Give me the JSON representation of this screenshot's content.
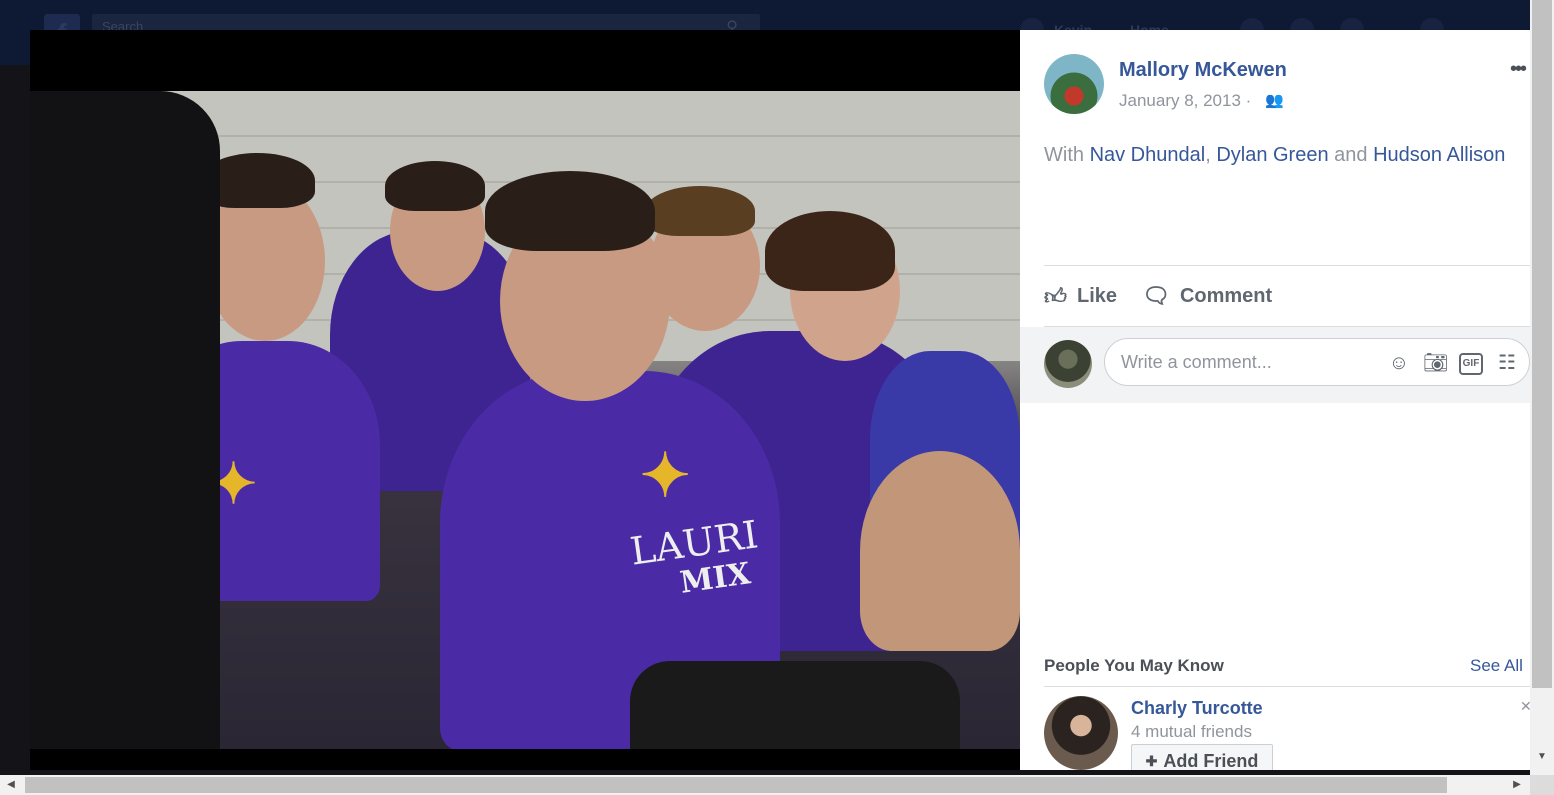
{
  "background_header": {
    "search_placeholder": "Search",
    "user_name": "Kevin",
    "home_label": "Home"
  },
  "post": {
    "author": "Mallory McKewen",
    "date": "January 8, 2013",
    "date_separator": "·",
    "audience_icon": "friends-icon",
    "tagline_prefix": "With",
    "tagged": [
      "Nav Dhundal",
      "Dylan Green",
      "Hudson Allison"
    ],
    "tag_separator": ",",
    "tag_conjunction": "and",
    "more_icon": "ellipsis-icon"
  },
  "actions": {
    "like_label": "Like",
    "comment_label": "Comment"
  },
  "comment": {
    "placeholder": "Write a comment...",
    "icons": [
      "emoji-icon",
      "camera-icon",
      "gif-icon",
      "sticker-icon"
    ],
    "gif_text": "GIF"
  },
  "pymk": {
    "title": "People You May Know",
    "see_all": "See All",
    "person": {
      "name": "Charly Turcotte",
      "mutual": "4 mutual friends",
      "add_label": "Add Friend"
    }
  },
  "photo": {
    "shirt_text_1": "LAURI",
    "shirt_text_2": "MIX"
  },
  "colors": {
    "link": "#365899",
    "muted": "#90949c",
    "shirt_purple": "#4b2aa6",
    "logo_gold": "#e5b52a"
  }
}
